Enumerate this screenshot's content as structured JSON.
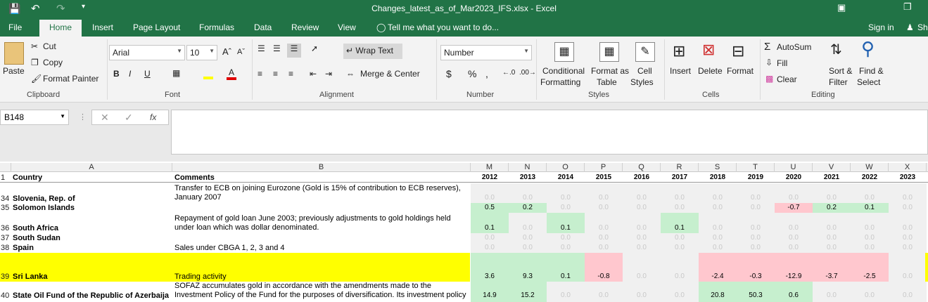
{
  "window": {
    "title": "Changes_latest_as_of_Mar2023_IFS.xlsx - Excel"
  },
  "tabs": [
    "File",
    "Home",
    "Insert",
    "Page Layout",
    "Formulas",
    "Data",
    "Review",
    "View"
  ],
  "tellme": "Tell me what you want to do...",
  "signin": "Sign in",
  "share": "Sh",
  "ribbon": {
    "clipboard": {
      "paste": "Paste",
      "cut": "Cut",
      "copy": "Copy",
      "format_painter": "Format Painter",
      "label": "Clipboard"
    },
    "font": {
      "name": "Arial",
      "size": "10",
      "label": "Font"
    },
    "alignment": {
      "wrap": "Wrap Text",
      "merge": "Merge & Center",
      "label": "Alignment"
    },
    "number": {
      "format": "Number",
      "label": "Number"
    },
    "styles": {
      "conditional_1": "Conditional",
      "conditional_2": "Formatting",
      "format_as_1": "Format as",
      "format_as_2": "Table",
      "cell_1": "Cell",
      "cell_2": "Styles",
      "label": "Styles"
    },
    "cells": {
      "insert": "Insert",
      "delete": "Delete",
      "format": "Format",
      "label": "Cells"
    },
    "editing": {
      "autosum": "AutoSum",
      "fill": "Fill",
      "clear": "Clear",
      "sort_1": "Sort &",
      "sort_2": "Filter",
      "find_1": "Find &",
      "find_2": "Select",
      "label": "Editing"
    }
  },
  "namebox": "B148",
  "columns": {
    "A": "A",
    "B": "B",
    "years": [
      {
        "col": "M",
        "year": "2012"
      },
      {
        "col": "N",
        "year": "2013"
      },
      {
        "col": "O",
        "year": "2014"
      },
      {
        "col": "P",
        "year": "2015"
      },
      {
        "col": "Q",
        "year": "2016"
      },
      {
        "col": "R",
        "year": "2017"
      },
      {
        "col": "S",
        "year": "2018"
      },
      {
        "col": "T",
        "year": "2019"
      },
      {
        "col": "U",
        "year": "2020"
      },
      {
        "col": "V",
        "year": "2021"
      },
      {
        "col": "W",
        "year": "2022"
      },
      {
        "col": "X",
        "year": "2023"
      }
    ]
  },
  "header_row": {
    "num": "1",
    "country": "Country",
    "comments": "Comments"
  },
  "rows": [
    {
      "num": "34",
      "country": "Slovenia, Rep. of",
      "comment": "Transfer to ECB on joining Eurozone (Gold is 15% of contribution to ECB reserves), January 2007",
      "values": [
        "0.0",
        "0.0",
        "0.0",
        "0.0",
        "0.0",
        "0.0",
        "0.0",
        "0.0",
        "0.0",
        "0.0",
        "0.0",
        "0.0"
      ],
      "fmt": [
        "z",
        "z",
        "z",
        "z",
        "z",
        "z",
        "z",
        "z",
        "z",
        "z",
        "z",
        "z"
      ]
    },
    {
      "num": "35",
      "country": "Solomon Islands",
      "comment": "",
      "values": [
        "0.5",
        "0.2",
        "0.0",
        "0.0",
        "0.0",
        "0.0",
        "0.0",
        "0.0",
        "-0.7",
        "0.2",
        "0.1",
        "0.0"
      ],
      "fmt": [
        "g",
        "g",
        "z",
        "z",
        "z",
        "z",
        "z",
        "z",
        "r",
        "g",
        "g",
        "z"
      ]
    },
    {
      "num": "36",
      "country": "South Africa",
      "comment": "Repayment of gold loan June 2003; previously adjustments to gold holdings held under loan which was dollar denominated.",
      "values": [
        "0.1",
        "0.0",
        "0.1",
        "0.0",
        "0.0",
        "0.1",
        "0.0",
        "0.0",
        "0.0",
        "0.0",
        "0.0",
        "0.0"
      ],
      "fmt": [
        "g",
        "z",
        "g",
        "z",
        "z",
        "g",
        "z",
        "z",
        "z",
        "z",
        "z",
        "z"
      ]
    },
    {
      "num": "37",
      "country": "South Sudan",
      "comment": "",
      "values": [
        "0.0",
        "0.0",
        "0.0",
        "0.0",
        "0.0",
        "0.0",
        "0.0",
        "0.0",
        "0.0",
        "0.0",
        "0.0",
        "0.0"
      ],
      "fmt": [
        "z",
        "z",
        "z",
        "z",
        "z",
        "z",
        "z",
        "z",
        "z",
        "z",
        "z",
        "z"
      ]
    },
    {
      "num": "38",
      "country": "Spain",
      "comment": "Sales under CBGA 1, 2, 3 and 4",
      "values": [
        "0.0",
        "0.0",
        "0.0",
        "0.0",
        "0.0",
        "0.0",
        "0.0",
        "0.0",
        "0.0",
        "0.0",
        "0.0",
        "0.0"
      ],
      "fmt": [
        "z",
        "z",
        "z",
        "z",
        "z",
        "z",
        "z",
        "z",
        "z",
        "z",
        "z",
        "z"
      ]
    },
    {
      "num": "39",
      "country": "Sri Lanka",
      "comment": "Trading activity",
      "values": [
        "3.6",
        "9.3",
        "0.1",
        "-0.8",
        "0.0",
        "0.0",
        "-2.4",
        "-0.3",
        "-12.9",
        "-3.7",
        "-2.5",
        "0.0"
      ],
      "fmt": [
        "g",
        "g",
        "g",
        "r",
        "z",
        "z",
        "r",
        "r",
        "r",
        "r",
        "r",
        "z"
      ]
    },
    {
      "num": "40",
      "country": "State Oil Fund of the Republic of Azerbaija",
      "comment": "SOFAZ accumulates gold in accordance with the amendments made to the Investment Policy of the Fund for the purposes of diversification. Its investment policy was",
      "values": [
        "14.9",
        "15.2",
        "0.0",
        "0.0",
        "0.0",
        "0.0",
        "20.8",
        "50.3",
        "0.6",
        "0.0",
        "0.0",
        "0.0"
      ],
      "fmt": [
        "g",
        "g",
        "z",
        "z",
        "z",
        "z",
        "g",
        "g",
        "g",
        "z",
        "z",
        "z"
      ]
    }
  ]
}
